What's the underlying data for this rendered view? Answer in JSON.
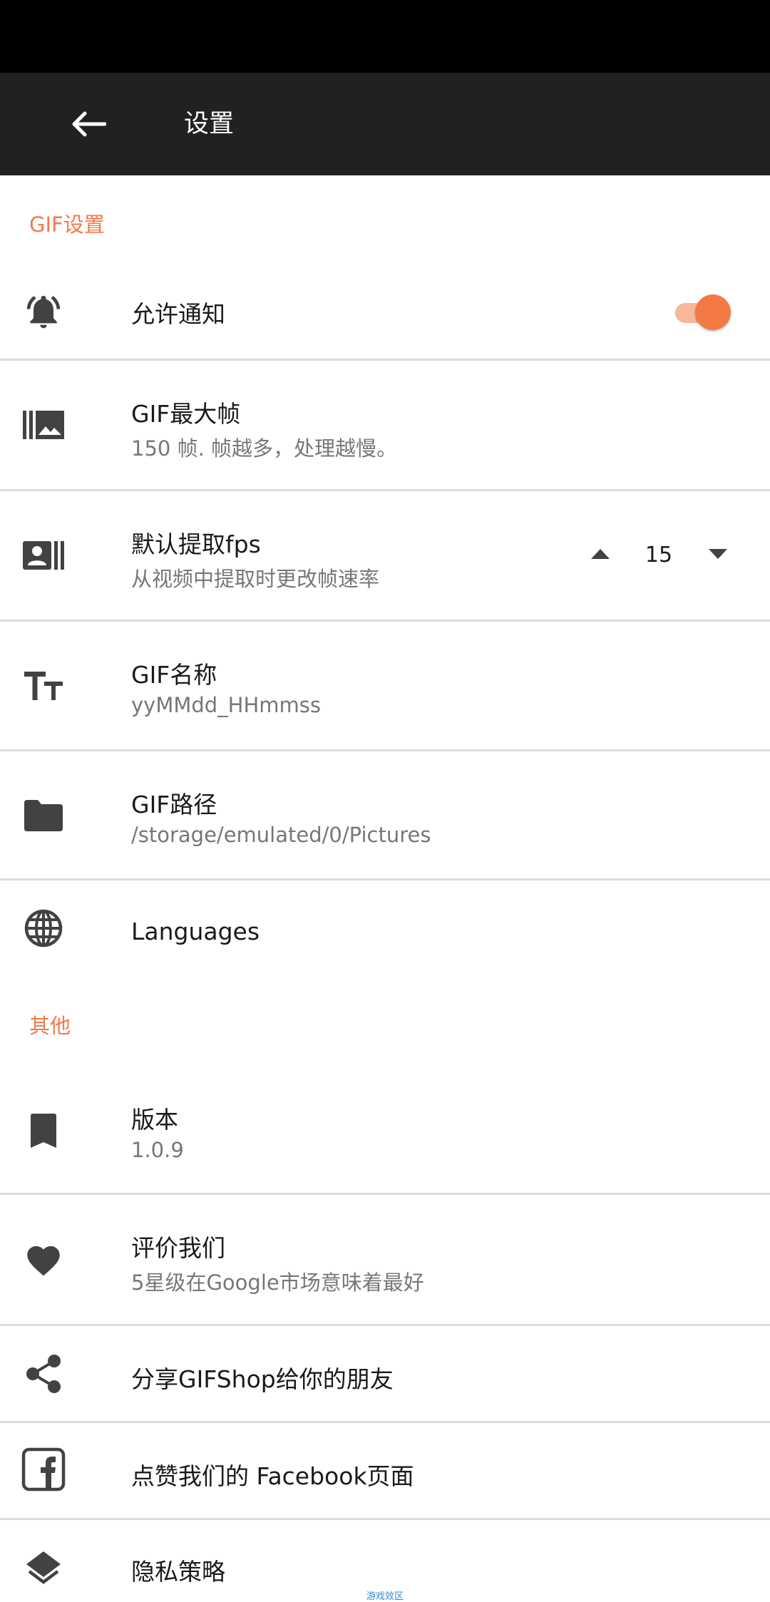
{
  "app_bar": {
    "title": "设置"
  },
  "sections": {
    "gif_settings": "GIF设置",
    "other": "其他"
  },
  "notifications": {
    "title": "允许通知",
    "enabled": true
  },
  "max_frames": {
    "title": "GIF最大帧",
    "subtitle": "150 帧. 帧越多，处理越慢。"
  },
  "fps": {
    "title": "默认提取fps",
    "subtitle": "从视频中提取时更改帧速率",
    "value": "15"
  },
  "gif_name": {
    "title": "GIF名称",
    "subtitle": "yyMMdd_HHmmss"
  },
  "gif_path": {
    "title": "GIF路径",
    "subtitle": "/storage/emulated/0/Pictures"
  },
  "languages": {
    "title": "Languages"
  },
  "version": {
    "title": "版本",
    "subtitle": "1.0.9"
  },
  "rate": {
    "title": "评价我们",
    "subtitle": "5星级在Google市场意味着最好"
  },
  "share": {
    "title": "分享GIFShop给你的朋友"
  },
  "facebook": {
    "title": "点赞我们的 Facebook页面"
  },
  "privacy": {
    "title": "隐私策略"
  },
  "watermark": "游戏效区",
  "colors": {
    "accent": "#F47A45",
    "appbar": "#212121",
    "icon": "#424242"
  },
  "icons": {
    "back": "arrow-left-icon",
    "notifications": "bell-ringing-icon",
    "max_frames": "photo-library-icon",
    "fps": "contact-card-icon",
    "gif_name": "text-size-icon",
    "gif_path": "folder-icon",
    "languages": "globe-icon",
    "version": "bookmark-icon",
    "rate": "heart-icon",
    "share": "share-icon",
    "facebook": "facebook-icon",
    "privacy": "layers-icon"
  }
}
